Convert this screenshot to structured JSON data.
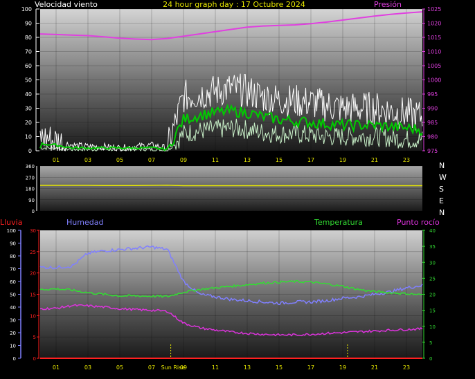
{
  "header": {
    "left_label": "Velocidad viento",
    "title": "24 hour graph day : 17 Octubre 2024",
    "right_label": "Presión"
  },
  "lower_header": {
    "rain": "Lluvia",
    "humidity": "Humedad",
    "temperature": "Temperatura",
    "dewpoint": "Punto rocío"
  },
  "colors": {
    "pressure": "#e040e0",
    "wind_gust": "#ffffff",
    "wind_avg": "#00cc00",
    "wind_light": "#c8f0c8",
    "direction": "#e8e800",
    "humidity": "#8080ff",
    "temperature": "#33dd33",
    "dewpoint": "#dd33dd",
    "rain": "#ff2020",
    "title": "#e8e800",
    "tick_yellow": "#e8e800"
  },
  "chart_data": [
    {
      "type": "line",
      "name": "wind-pressure",
      "x_ticks": [
        "01",
        "03",
        "05",
        "07",
        "09",
        "11",
        "13",
        "15",
        "17",
        "19",
        "21",
        "23"
      ],
      "y_left_ticks": [
        "100",
        "90",
        "80",
        "70",
        "60",
        "50",
        "40",
        "30",
        "20",
        "10",
        "0"
      ],
      "y_right_ticks": [
        "1025",
        "1020",
        "1015",
        "1010",
        "1005",
        "1000",
        "995",
        "990",
        "985",
        "980",
        "975"
      ],
      "ylim_left": [
        0,
        100
      ],
      "ylim_right": [
        975,
        1025
      ],
      "hours": [
        0,
        1,
        2,
        3,
        4,
        5,
        6,
        7,
        8,
        9,
        10,
        11,
        12,
        13,
        14,
        15,
        16,
        17,
        18,
        19,
        20,
        21,
        22,
        23,
        24
      ],
      "pressure": [
        1016.2,
        1016.0,
        1015.8,
        1015.6,
        1015.2,
        1014.7,
        1014.4,
        1014.2,
        1014.6,
        1015.4,
        1016.2,
        1017.0,
        1017.8,
        1018.6,
        1019.0,
        1019.2,
        1019.4,
        1019.8,
        1020.4,
        1021.1,
        1021.8,
        1022.5,
        1023.1,
        1023.6,
        1024.0
      ],
      "wind_gust": [
        10,
        7,
        4,
        3,
        3,
        2,
        3,
        4,
        2,
        38,
        40,
        42,
        44,
        42,
        38,
        36,
        35,
        34,
        32,
        30,
        30,
        30,
        28,
        26,
        24
      ],
      "wind_avg": [
        5,
        4,
        2,
        2,
        2,
        2,
        2,
        2,
        1,
        22,
        25,
        27,
        28,
        27,
        24,
        22,
        21,
        20,
        19,
        18,
        18,
        18,
        17,
        16,
        15
      ],
      "wind_light": [
        2,
        2,
        1,
        1,
        1,
        1,
        1,
        1,
        0,
        12,
        14,
        15,
        16,
        15,
        13,
        12,
        12,
        11,
        10,
        10,
        10,
        10,
        9,
        8,
        8
      ]
    },
    {
      "type": "line",
      "name": "wind-direction",
      "y_left_ticks": [
        "360",
        "270",
        "180",
        "90",
        "0"
      ],
      "direction_letters": [
        "N",
        "W",
        "S",
        "E",
        "N"
      ],
      "ylim": [
        0,
        360
      ],
      "hours": [
        0,
        1,
        2,
        3,
        4,
        5,
        6,
        7,
        8,
        9,
        10,
        11,
        12,
        13,
        14,
        15,
        16,
        17,
        18,
        19,
        20,
        21,
        22,
        23,
        24
      ],
      "direction": [
        205,
        205,
        205,
        205,
        204,
        204,
        204,
        205,
        206,
        202,
        202,
        202,
        202,
        202,
        202,
        202,
        202,
        202,
        202,
        202,
        202,
        202,
        202,
        202,
        202
      ]
    },
    {
      "type": "line",
      "name": "humidity-temperature",
      "x_ticks": [
        "01",
        "03",
        "05",
        "07",
        "09",
        "11",
        "13",
        "15",
        "17",
        "19",
        "21",
        "23"
      ],
      "rain_ticks": [
        "30",
        "25",
        "20",
        "15",
        "10",
        "5",
        "0"
      ],
      "humidity_ticks": [
        "100",
        "90",
        "80",
        "70",
        "60",
        "50",
        "40",
        "30",
        "20",
        "10",
        "0"
      ],
      "temp_ticks": [
        "40",
        "35",
        "30",
        "25",
        "20",
        "15",
        "10",
        "5",
        "0"
      ],
      "ylim_rain": [
        0,
        30
      ],
      "ylim_humidity": [
        0,
        100
      ],
      "ylim_temp": [
        0,
        40
      ],
      "hours": [
        0,
        1,
        2,
        3,
        4,
        5,
        6,
        7,
        8,
        9,
        10,
        11,
        12,
        13,
        14,
        15,
        16,
        17,
        18,
        19,
        20,
        21,
        22,
        23,
        24
      ],
      "humidity": [
        71,
        71,
        72,
        82,
        84,
        85,
        86,
        87,
        85,
        60,
        50,
        48,
        46,
        45,
        44,
        43,
        44,
        44,
        45,
        47,
        48,
        50,
        52,
        55,
        57
      ],
      "temperature": [
        21.5,
        21.7,
        21.3,
        20.5,
        20.0,
        19.5,
        19.5,
        19.4,
        19.3,
        20.7,
        21.5,
        22.0,
        22.5,
        23.0,
        23.5,
        23.8,
        24.0,
        23.8,
        23.2,
        22.5,
        21.5,
        20.8,
        20.5,
        20.2,
        19.8
      ],
      "dewpoint": [
        15.5,
        15.6,
        16.5,
        16.4,
        16.0,
        15.5,
        15.2,
        15.0,
        14.7,
        11.0,
        9.5,
        8.8,
        8.2,
        7.8,
        7.5,
        7.3,
        7.3,
        7.5,
        7.8,
        8.0,
        8.3,
        8.5,
        8.8,
        9.0,
        9.2
      ],
      "rain": [
        0,
        0,
        0,
        0,
        0,
        0,
        0,
        0,
        0,
        0,
        0,
        0,
        0,
        0,
        0,
        0,
        0,
        0,
        0,
        0,
        0,
        0,
        0,
        0,
        0
      ],
      "sunrise_label": "Sun Rise",
      "sunrise_hour": 8.2,
      "sunset_hour": 19.3
    }
  ]
}
